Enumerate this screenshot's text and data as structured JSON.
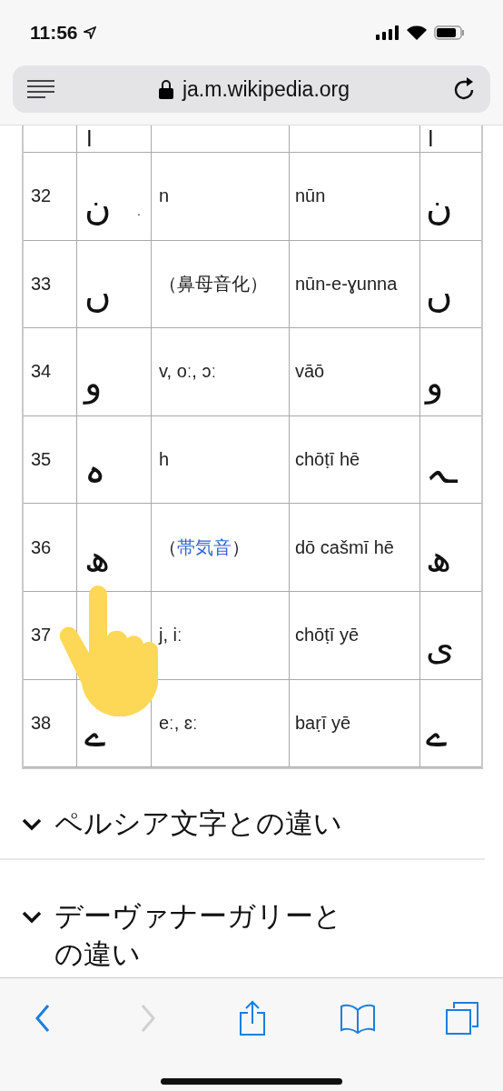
{
  "status_bar": {
    "time": "11:56"
  },
  "address_bar": {
    "url": "ja.m.wikipedia.org",
    "secure": true
  },
  "table": {
    "partial_row": {
      "letter": "ا",
      "final_form": "ا"
    },
    "rows": [
      {
        "number": "32",
        "letter": "ن",
        "mark": ".",
        "sound": [
          {
            "kind": "text",
            "text": "n"
          }
        ],
        "name": "nūn",
        "final_form": "ن"
      },
      {
        "number": "33",
        "letter": "ں",
        "sound": [
          {
            "kind": "text",
            "text": "（鼻母音化）"
          }
        ],
        "name": "nūn-e-ɣunna",
        "final_form": "ں"
      },
      {
        "number": "34",
        "letter": "و",
        "sound": [
          {
            "kind": "text",
            "text": "v, oː, ɔː"
          }
        ],
        "name": "vāō",
        "final_form": "و"
      },
      {
        "number": "35",
        "letter": "ہ",
        "sound": [
          {
            "kind": "text",
            "text": "h"
          }
        ],
        "name": "chōṭī hē",
        "final_form": "ـہ"
      },
      {
        "number": "36",
        "letter": "ھ",
        "sound": [
          {
            "kind": "text",
            "text": "（"
          },
          {
            "kind": "link",
            "text": "帯気音"
          },
          {
            "kind": "text",
            "text": "）"
          }
        ],
        "name": "dō cašmī hē",
        "final_form": "ھ"
      },
      {
        "number": "37",
        "sound": [
          {
            "kind": "text",
            "text": "j, iː"
          }
        ],
        "name": "chōṭī yē",
        "final_form": "ی"
      },
      {
        "number": "38",
        "letter": "ے",
        "sound": [
          {
            "kind": "text",
            "text": "eː, ɛː"
          }
        ],
        "name": "baṛī yē",
        "final_form": "ے"
      }
    ]
  },
  "sections": [
    {
      "title": "ペルシア文字との違い",
      "expanded": false
    },
    {
      "title": "デーヴァナーガリーとの違い",
      "expanded": false
    }
  ],
  "toolbar": [
    {
      "kind": "back",
      "disabled": false
    },
    {
      "kind": "forward",
      "disabled": true
    },
    {
      "kind": "share",
      "disabled": false
    },
    {
      "kind": "bookmarks",
      "disabled": false
    },
    {
      "kind": "tabs",
      "disabled": false
    }
  ]
}
